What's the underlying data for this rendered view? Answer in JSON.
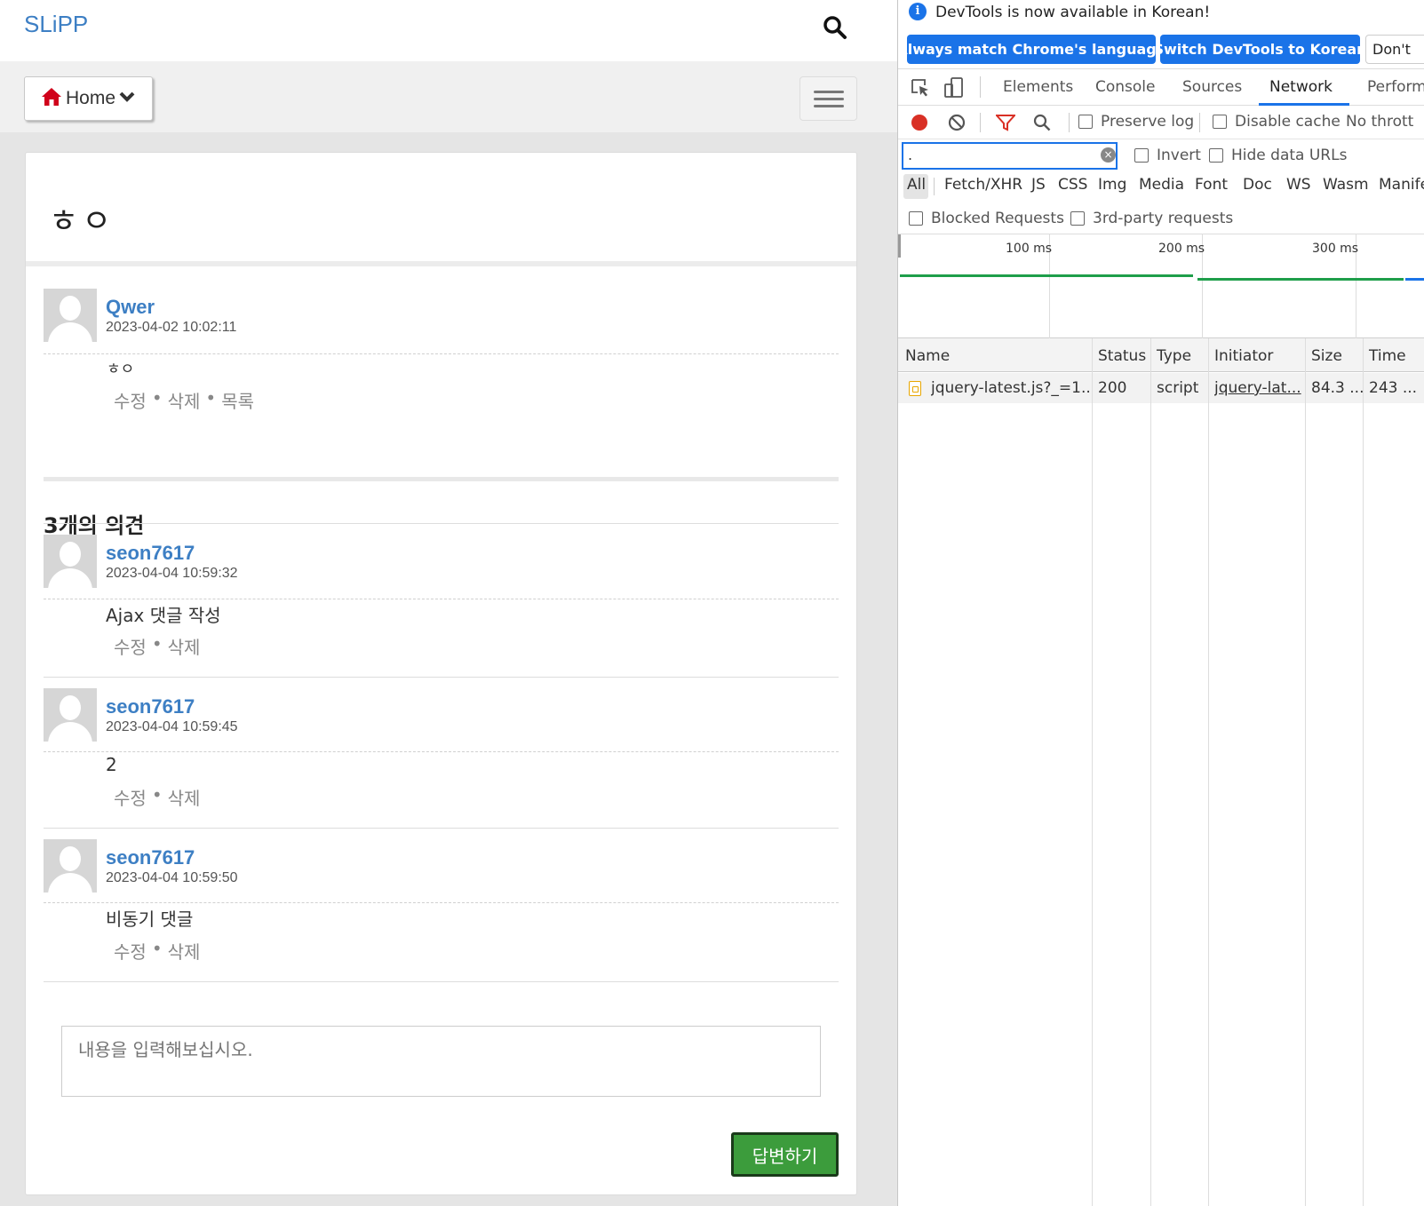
{
  "page": {
    "brand": "SLiPP",
    "nav": {
      "home_label": "Home"
    },
    "question": {
      "title": "ㅎㅇ",
      "author": "Qwer",
      "date": "2023-04-02 10:02:11",
      "body": "ㅎㅇ",
      "actions": [
        "수정",
        "삭제",
        "목록"
      ]
    },
    "comments_heading": "3개의 의견",
    "comments": [
      {
        "author": "seon7617",
        "date": "2023-04-04 10:59:32",
        "body": "Ajax 댓글 작성",
        "actions": [
          "수정",
          "삭제"
        ]
      },
      {
        "author": "seon7617",
        "date": "2023-04-04 10:59:45",
        "body": "2",
        "actions": [
          "수정",
          "삭제"
        ]
      },
      {
        "author": "seon7617",
        "date": "2023-04-04 10:59:50",
        "body": "비동기 댓글",
        "actions": [
          "수정",
          "삭제"
        ]
      }
    ],
    "reply": {
      "placeholder": "내용을 입력해보십시오.",
      "submit_label": "답변하기"
    },
    "colors": {
      "brand": "#3d7fc4",
      "home_icon": "#d0021b",
      "submit": "#3c9c3c"
    }
  },
  "devtools": {
    "info": {
      "text": "DevTools is now available in Korean!",
      "btn_match": "Always match Chrome's language",
      "btn_switch": "Switch DevTools to Korean",
      "btn_dont": "Don't"
    },
    "tabs": [
      "Elements",
      "Console",
      "Sources",
      "Network",
      "Perform"
    ],
    "active_tab": "Network",
    "toolbar": {
      "preserve_log": "Preserve log",
      "disable_cache": "Disable cache",
      "throttle": "No thrott"
    },
    "filter": {
      "value": ".",
      "invert": "Invert",
      "hide_data_urls": "Hide data URLs"
    },
    "types": [
      "All",
      "Fetch/XHR",
      "JS",
      "CSS",
      "Img",
      "Media",
      "Font",
      "Doc",
      "WS",
      "Wasm",
      "Manife"
    ],
    "checks": {
      "blocked": "Blocked Requests",
      "third_party": "3rd-party requests"
    },
    "timeline": {
      "ticks": [
        "100 ms",
        "200 ms",
        "300 ms"
      ]
    },
    "table": {
      "columns": [
        "Name",
        "Status",
        "Type",
        "Initiator",
        "Size",
        "Time"
      ],
      "rows": [
        {
          "name": "jquery-latest.js?_=1...",
          "status": "200",
          "type": "script",
          "initiator": "jquery-lat...",
          "size": "84.3 ...",
          "time": "243 ..."
        }
      ]
    },
    "colors": {
      "accent": "#1a73e8",
      "record": "#d93025",
      "filter_icon": "#d93025",
      "timeline_bar": "#1e9e4a"
    }
  }
}
